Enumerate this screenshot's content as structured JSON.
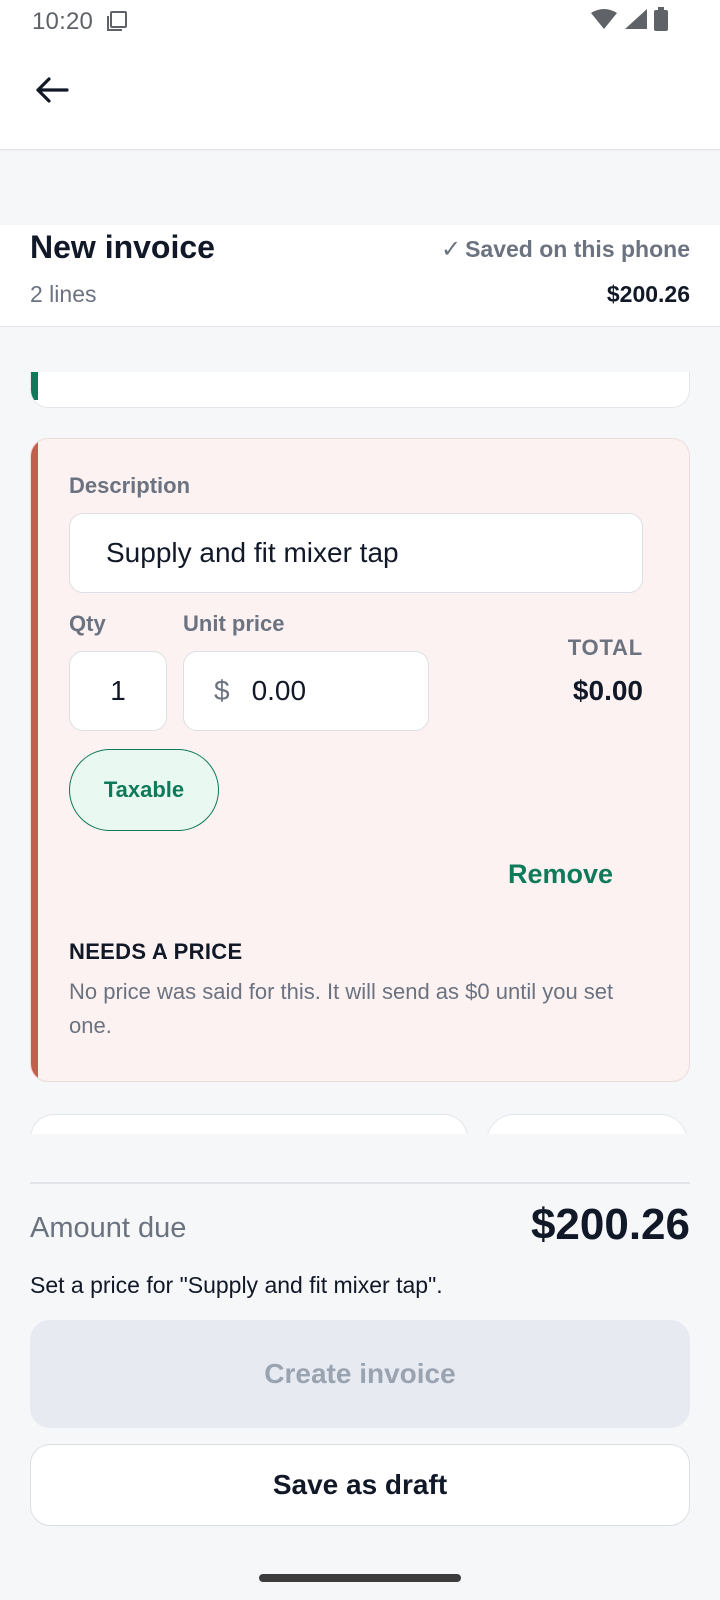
{
  "status_bar": {
    "time": "10:20",
    "icons": [
      "screenshot-icon",
      "wifi-icon",
      "signal-icon",
      "battery-icon"
    ]
  },
  "app_bar": {
    "back_icon": "arrow-left-icon"
  },
  "summary": {
    "title": "New invoice",
    "saved_icon": "check-icon",
    "saved_check": "✓",
    "saved_text": "Saved on this phone",
    "line_count": "2 lines",
    "total": "$200.26"
  },
  "line_item": {
    "description_label": "Description",
    "description_value": "Supply and fit mixer tap",
    "qty_label": "Qty",
    "qty_value": "1",
    "unit_price_label": "Unit price",
    "currency_symbol": "$",
    "unit_price_value": "0.00",
    "total_label": "TOTAL",
    "total_value": "$0.00",
    "taxable_label": "Taxable",
    "remove_label": "Remove",
    "warning_title": "NEEDS A PRICE",
    "warning_text": "No price was said for this. It will send as $0 until you set one."
  },
  "footer": {
    "amount_label": "Amount due",
    "amount_value": "$200.26",
    "hint": "Set a price for \"Supply and fit mixer tap\".",
    "create_label": "Create invoice",
    "draft_label": "Save as draft"
  },
  "colors": {
    "accent_green": "#0f7a5a",
    "warning_red": "#c25f4f",
    "card_bg": "#fcf2f1",
    "disabled_bg": "#e8eaf2"
  }
}
